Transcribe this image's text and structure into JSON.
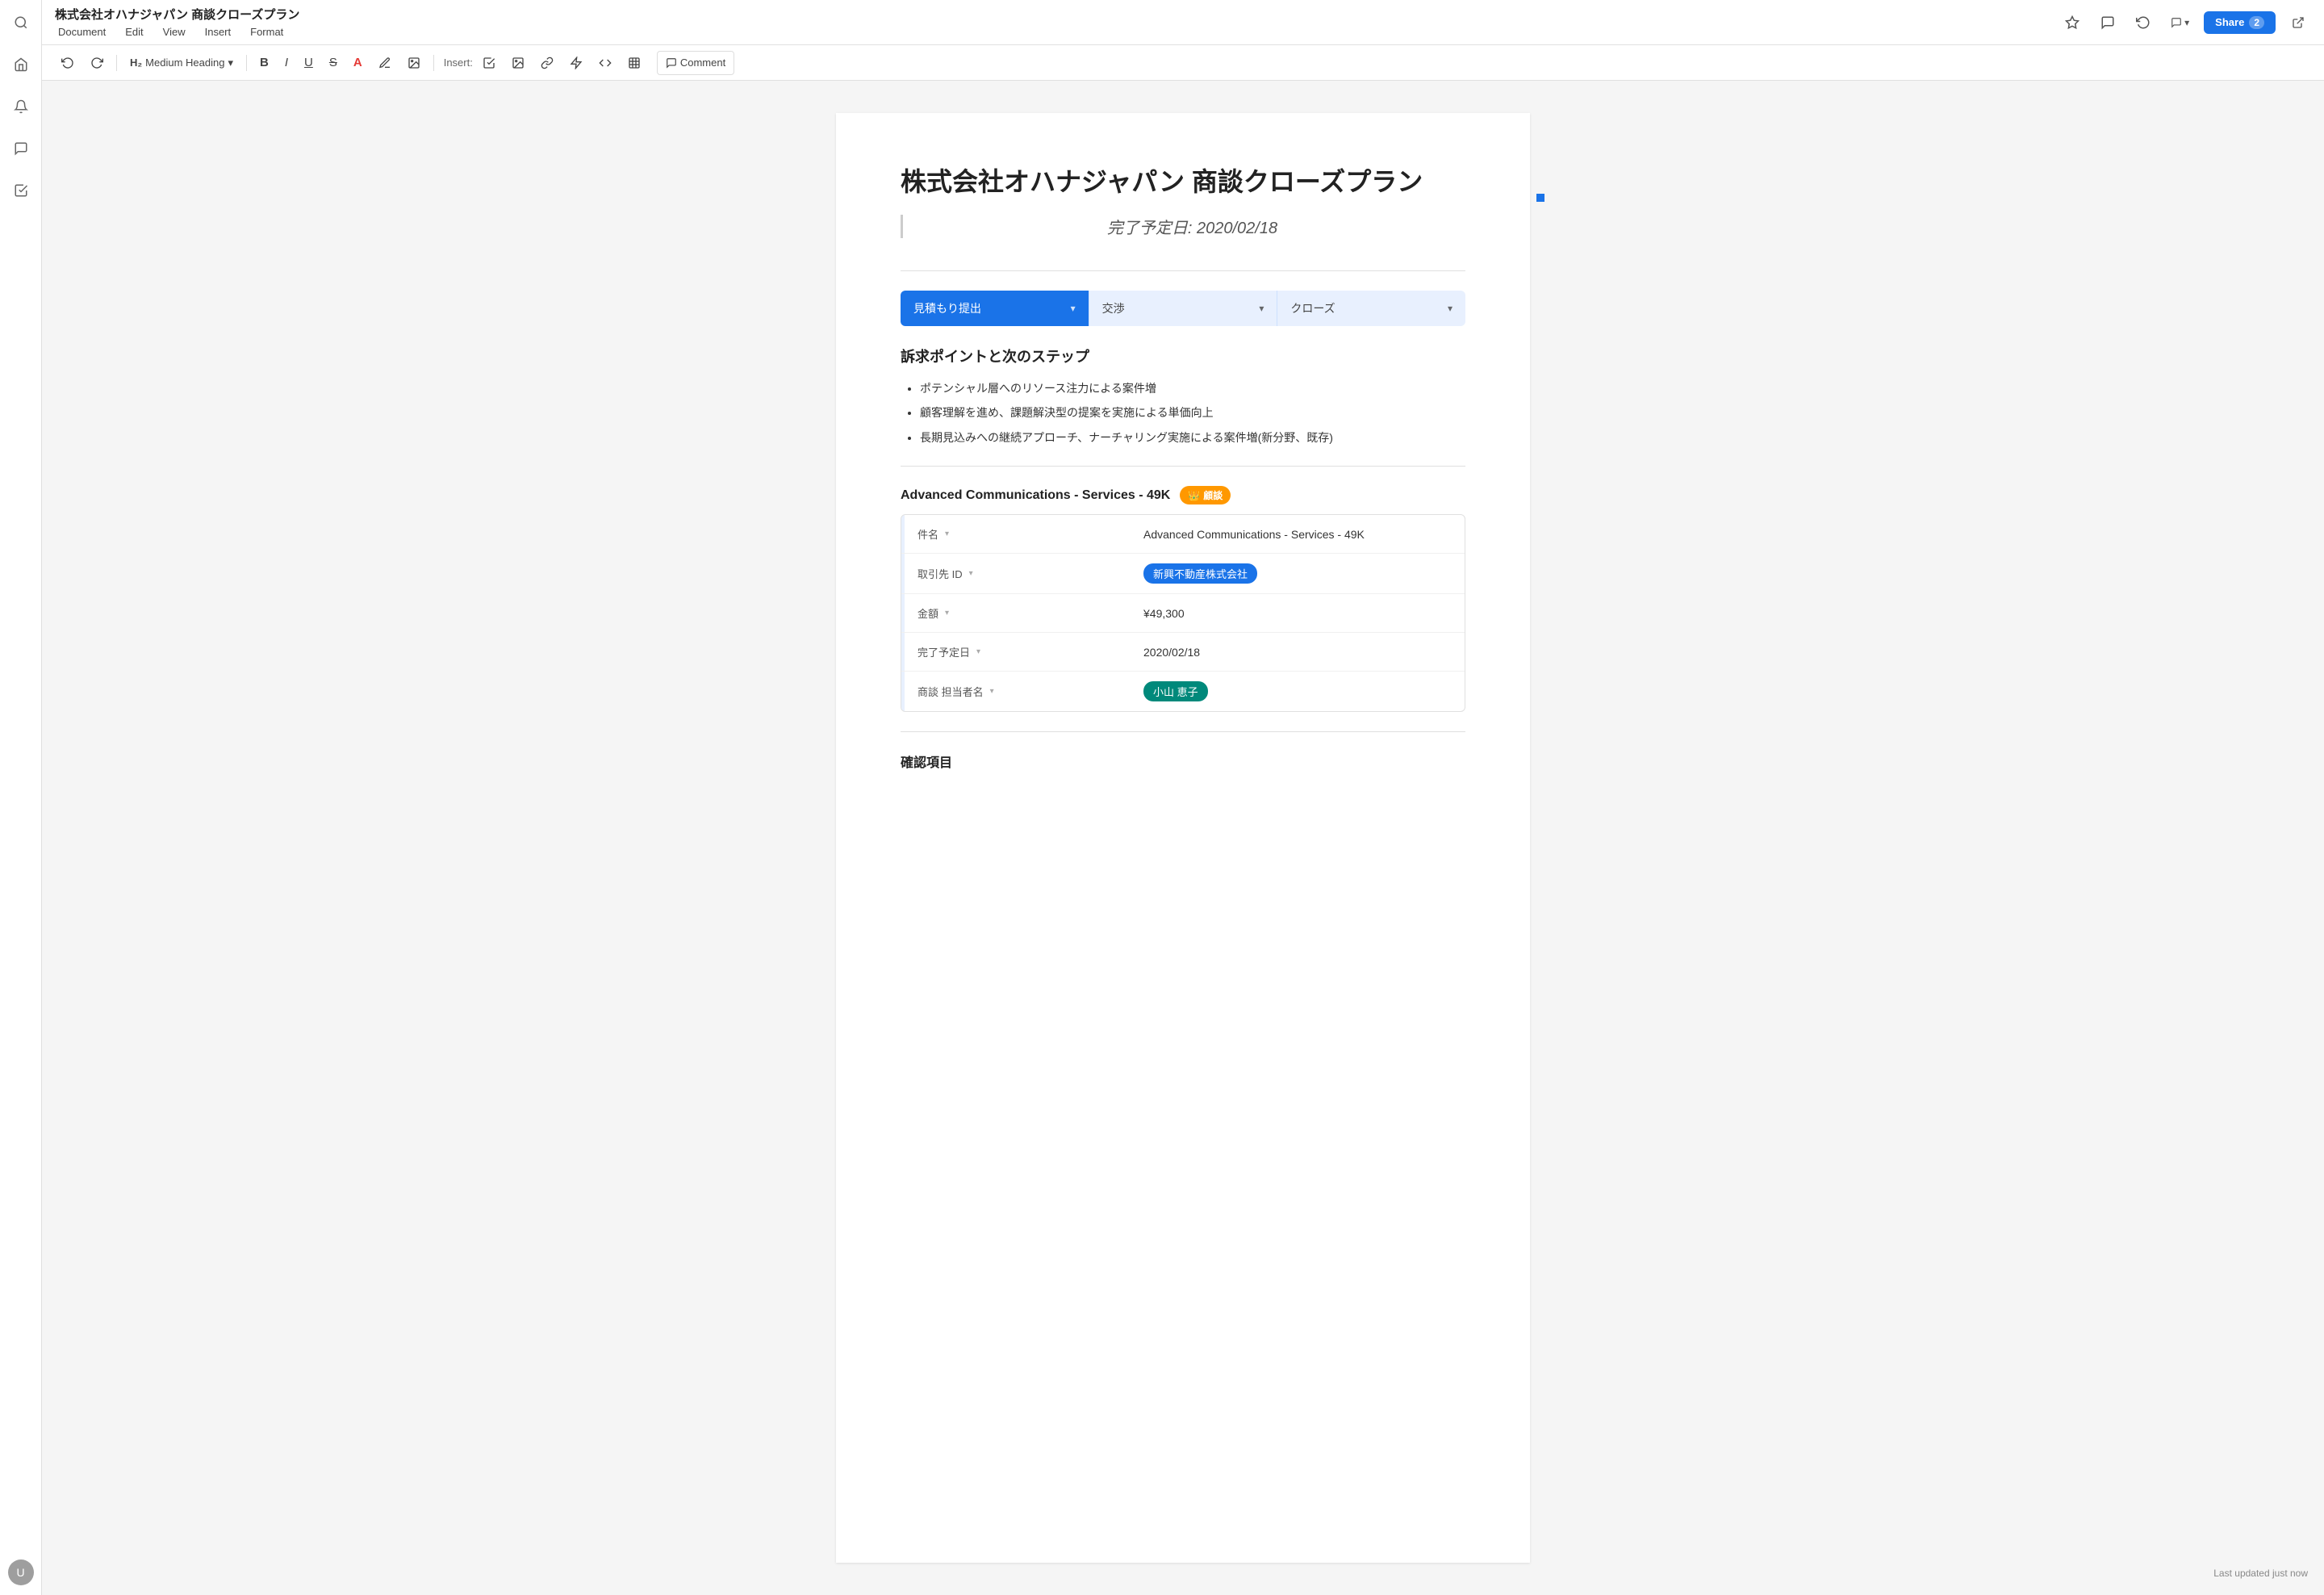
{
  "app": {
    "title": "株式会社オハナジャパン 商談クローズプラン"
  },
  "menu": {
    "items": [
      "Document",
      "Edit",
      "View",
      "Insert",
      "Format"
    ]
  },
  "toolbar": {
    "undo_label": "↩",
    "redo_label": "↪",
    "heading_label": "H₂ Medium Heading",
    "heading_chevron": "▾",
    "bold_label": "B",
    "italic_label": "I",
    "underline_label": "U",
    "strikethrough_label": "S",
    "font_color_label": "A",
    "highlight_label": "✏",
    "image_label": "⬜",
    "insert_label": "Insert:",
    "comment_label": "Comment"
  },
  "header_icons": {
    "star": "☆",
    "chat": "💬",
    "undo": "↩",
    "share_label": "Share",
    "share_count": "2",
    "external_link": "↗"
  },
  "document": {
    "main_title": "株式会社オハナジャパン 商談クローズプラン",
    "subtitle": "完了予定日: 2020/02/18",
    "pipeline": {
      "steps": [
        {
          "label": "見積もり提出",
          "state": "active"
        },
        {
          "label": "交渉",
          "state": "inactive"
        },
        {
          "label": "クローズ",
          "state": "inactive"
        }
      ]
    },
    "section1": {
      "heading": "訴求ポイントと次のステップ",
      "bullets": [
        "ポテンシャル層へのリソース注力による案件増",
        "顧客理解を進め、課題解決型の提案を実施による単価向上",
        "長期見込みへの継続アプローチ、ナーチャリング実施による案件増(新分野、既存)"
      ]
    },
    "opportunity": {
      "title": "Advanced Communications - Services - 49K",
      "badge_icon": "👑",
      "badge_label": "顧談",
      "table_rows": [
        {
          "label": "件名",
          "value": "Advanced Communications - Services - 49K",
          "value_type": "text"
        },
        {
          "label": "取引先 ID",
          "value": "新興不動産株式会社",
          "value_type": "tag-blue"
        },
        {
          "label": "金額",
          "value": "¥49,300",
          "value_type": "text"
        },
        {
          "label": "完了予定日",
          "value": "2020/02/18",
          "value_type": "text"
        },
        {
          "label": "商談 担当者名",
          "value": "小山 恵子",
          "value_type": "tag-teal"
        }
      ]
    },
    "section2": {
      "heading": "確認項目"
    }
  },
  "status": {
    "last_updated": "Last updated just now"
  },
  "sidebar": {
    "icons": [
      {
        "name": "search",
        "symbol": "🔍"
      },
      {
        "name": "home",
        "symbol": "🏠"
      },
      {
        "name": "bell",
        "symbol": "🔔"
      },
      {
        "name": "chat",
        "symbol": "💬"
      },
      {
        "name": "check",
        "symbol": "✓"
      }
    ],
    "avatar_initials": "U"
  }
}
